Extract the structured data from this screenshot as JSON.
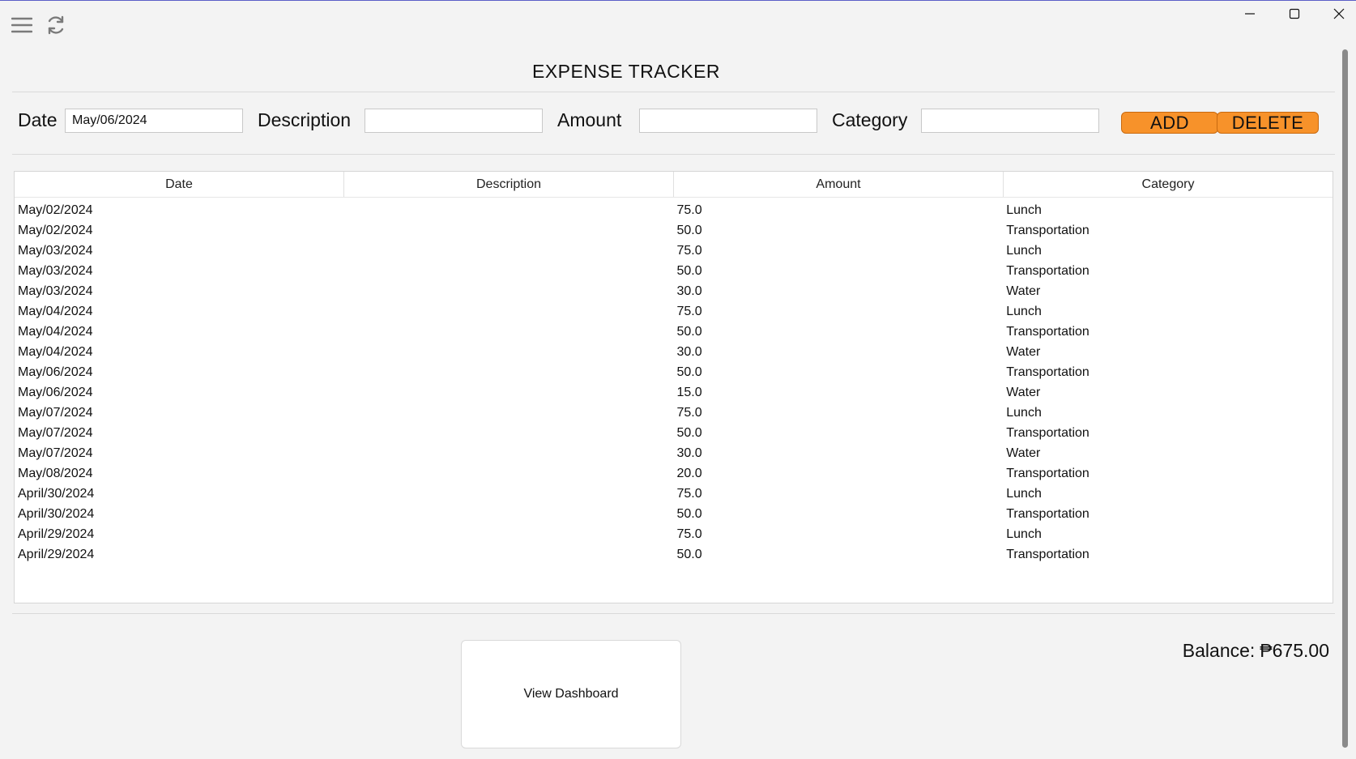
{
  "app": {
    "title": "EXPENSE TRACKER"
  },
  "window_controls": {
    "minimize_icon": "minimize-icon",
    "maximize_icon": "maximize-icon",
    "close_icon": "close-icon"
  },
  "toolbar": {
    "menu_icon": "hamburger-menu-icon",
    "refresh_icon": "refresh-icon"
  },
  "form": {
    "date_label": "Date",
    "date_value": "May/06/2024",
    "description_label": "Description",
    "description_value": "",
    "amount_label": "Amount",
    "amount_value": "",
    "category_label": "Category",
    "category_value": "",
    "add_label": "ADD",
    "delete_label": "DELETE",
    "button_color": "#f7922a"
  },
  "table": {
    "columns": [
      "Date",
      "Description",
      "Amount",
      "Category"
    ],
    "rows": [
      [
        "May/02/2024",
        "",
        "75.0",
        "Lunch"
      ],
      [
        "May/02/2024",
        "",
        "50.0",
        "Transportation"
      ],
      [
        "May/03/2024",
        "",
        "75.0",
        "Lunch"
      ],
      [
        "May/03/2024",
        "",
        "50.0",
        "Transportation"
      ],
      [
        "May/03/2024",
        "",
        "30.0",
        "Water"
      ],
      [
        "May/04/2024",
        "",
        "75.0",
        "Lunch"
      ],
      [
        "May/04/2024",
        "",
        "50.0",
        "Transportation"
      ],
      [
        "May/04/2024",
        "",
        "30.0",
        "Water"
      ],
      [
        "May/06/2024",
        "",
        "50.0",
        "Transportation"
      ],
      [
        "May/06/2024",
        "",
        "15.0",
        "Water"
      ],
      [
        "May/07/2024",
        "",
        "75.0",
        "Lunch"
      ],
      [
        "May/07/2024",
        "",
        "50.0",
        "Transportation"
      ],
      [
        "May/07/2024",
        "",
        "30.0",
        "Water"
      ],
      [
        "May/08/2024",
        "",
        "20.0",
        "Transportation"
      ],
      [
        "April/30/2024",
        "",
        "75.0",
        "Lunch"
      ],
      [
        "April/30/2024",
        "",
        "50.0",
        "Transportation"
      ],
      [
        "April/29/2024",
        "",
        "75.0",
        "Lunch"
      ],
      [
        "April/29/2024",
        "",
        "50.0",
        "Transportation"
      ]
    ]
  },
  "footer": {
    "dashboard_label": "View Dashboard",
    "balance_label": "Balance:",
    "balance_value": "₱675.00"
  }
}
